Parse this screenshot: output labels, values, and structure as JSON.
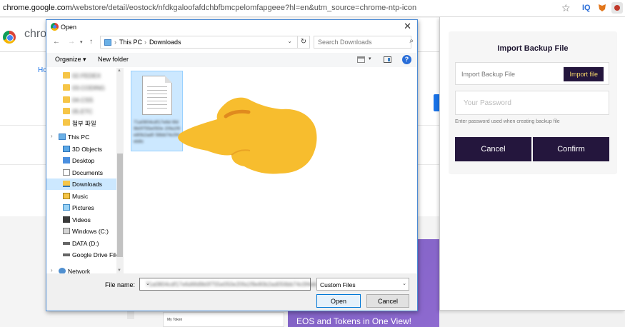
{
  "browser": {
    "url_prefix": "chrome.google.com",
    "url_rest": "/webstore/detail/eostock/nfdkgaloofafdchbfbmcpelomfapgeee?hl=en&utm_source=chrome-ntp-icon",
    "ext_label": "IQ"
  },
  "webstore": {
    "brand": "chro",
    "home_link": "Ho",
    "card_text": "My Token",
    "promo_text": "EOS and Tokens in One View!"
  },
  "popup": {
    "title": "Import Backup File",
    "file_placeholder": "Import Backup File",
    "file_button": "Import file",
    "password_placeholder": "Your Password",
    "hint": "Enter password used when creating backup file",
    "cancel": "Cancel",
    "confirm": "Confirm"
  },
  "dialog": {
    "title": "Open",
    "breadcrumb": [
      "This PC",
      "Downloads"
    ],
    "search_placeholder": "Search Downloads",
    "organize": "Organize",
    "new_folder": "New folder",
    "help": "?",
    "tree": [
      {
        "label": "02.FEDEX",
        "icon": "folder",
        "blur": true
      },
      {
        "label": "03.CODING",
        "icon": "folder",
        "blur": true
      },
      {
        "label": "04.CSS",
        "icon": "folder",
        "blur": true
      },
      {
        "label": "05.ETC",
        "icon": "folder",
        "blur": true
      },
      {
        "label": "첨부 파일",
        "icon": "folder",
        "blur": false
      },
      {
        "label": "This PC",
        "icon": "pc",
        "blur": false
      },
      {
        "label": "3D Objects",
        "icon": "folder-3d",
        "blur": false
      },
      {
        "label": "Desktop",
        "icon": "folder-dt",
        "blur": false
      },
      {
        "label": "Documents",
        "icon": "folder-doc",
        "blur": false
      },
      {
        "label": "Downloads",
        "icon": "folder-dl",
        "blur": false
      },
      {
        "label": "Music",
        "icon": "folder-mu",
        "blur": false
      },
      {
        "label": "Pictures",
        "icon": "folder-pi",
        "blur": false
      },
      {
        "label": "Videos",
        "icon": "folder-vi",
        "blur": false
      },
      {
        "label": "Windows (C:)",
        "icon": "drive",
        "blur": false
      },
      {
        "label": "DATA (D:)",
        "icon": "drive-dark",
        "blur": false
      },
      {
        "label": "Google Drive File",
        "icon": "drive-dark",
        "blur": false
      },
      {
        "label": "Network",
        "icon": "net",
        "blur": false
      }
    ],
    "selected_tree_item": "Downloads",
    "file_item_name": "71a0804cdf17e6d 6fd9b0f755e050e 20fa1f9e80b2ad0 56bb74c0f4eb8c",
    "file_name_label": "File name:",
    "file_name_value": "71a0804cdf17e6d6fd9b0f755e050e20fa1f9e80b2ad056bb74c0f4eb",
    "file_type": "Custom Files",
    "open": "Open",
    "cancel": "Cancel"
  },
  "colors": {
    "popup_dark": "#24163d",
    "popup_accent": "#f5d66a",
    "selection": "#cce8ff",
    "hand": "#f7bd2e"
  }
}
